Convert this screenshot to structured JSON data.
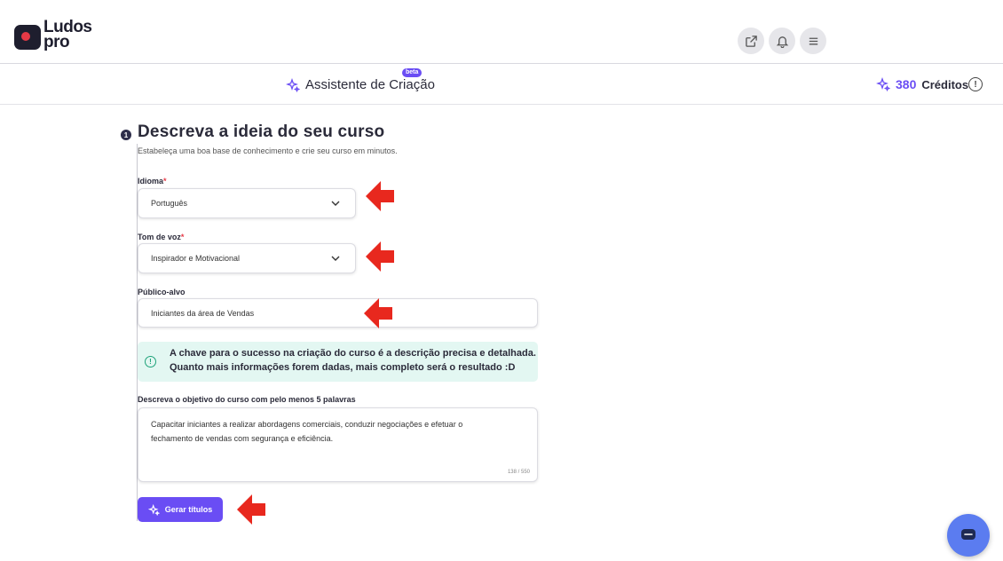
{
  "brand": {
    "logo_line1": "Ludos",
    "logo_line2": "pro"
  },
  "header": {
    "icons": [
      "external-link-icon",
      "bell-icon",
      "menu-icon"
    ]
  },
  "subheader": {
    "assistant_label": "Assistente de Criação",
    "beta_badge": "beta",
    "credits_value": "380",
    "credits_label": "Créditos"
  },
  "step": {
    "number": "1",
    "title": "Descreva a ideia do seu curso",
    "subtitle": "Estabeleça uma boa base de conhecimento e crie seu curso em minutos."
  },
  "form": {
    "language": {
      "label": "Idioma",
      "required_mark": "*",
      "value": "Português"
    },
    "tone": {
      "label": "Tom de voz",
      "required_mark": "*",
      "value": "Inspirador e Motivacional"
    },
    "audience": {
      "label": "Público-alvo",
      "value": "Iniciantes da área de Vendas"
    },
    "notice": {
      "line1": "A chave para o sucesso na criação do curso é a descrição precisa e detalhada.",
      "line2": "Quanto mais informações forem dadas, mais completo será o resultado :D"
    },
    "objective": {
      "label": "Descreva o objetivo do curso com pelo menos 5 palavras",
      "value": "Capacitar iniciantes a realizar abordagens comerciais, conduzir negociações e efetuar o fechamento de vendas com segurança e eficiência.",
      "counter": "138 / 550"
    },
    "generate_button": "Gerar títulos"
  },
  "colors": {
    "accent": "#6a4df4",
    "annotation_arrow": "#e8281e",
    "notice_bg": "#e3f7f2",
    "chat_fab": "#5b7cf0"
  }
}
